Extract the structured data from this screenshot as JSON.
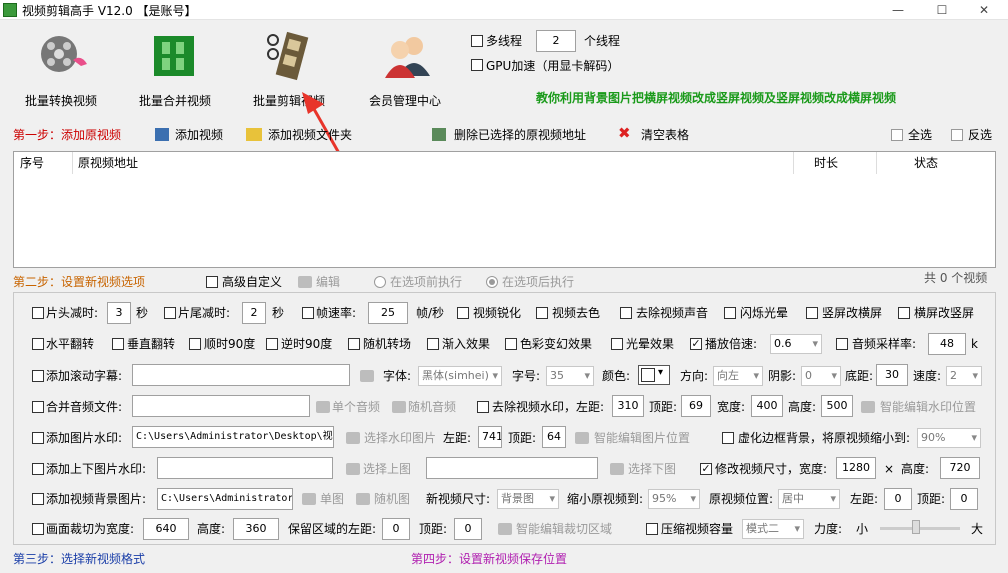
{
  "window": {
    "title": "视频剪辑高手 V12.0 【是账号】",
    "min": "—",
    "max": "☐",
    "close": "✕"
  },
  "toolbar": {
    "items": [
      {
        "label": "批量转换视频",
        "icon": "film-reel-icon"
      },
      {
        "label": "批量合并视频",
        "icon": "film-merge-icon"
      },
      {
        "label": "批量剪辑视频",
        "icon": "film-cut-icon"
      },
      {
        "label": "会员管理中心",
        "icon": "members-icon"
      }
    ],
    "multithread_label": "多线程",
    "threads": "2",
    "threads_unit": "个线程",
    "gpu_label": "GPU加速（用显卡解码）",
    "tutorial_link": "教你利用背景图片把横屏视频改成竖屏视频及竖屏视频改成横屏视频"
  },
  "step1": {
    "title": "第一步：添加原视频",
    "add_video": "添加视频",
    "add_folder": "添加视频文件夹",
    "delete_selected": "删除已选择的原视频地址",
    "clear": "清空表格",
    "select_all": "全选",
    "invert": "反选"
  },
  "table": {
    "headers": [
      "序号",
      "原视频地址",
      "时长",
      "状态"
    ]
  },
  "step2": {
    "title": "第二步：设置新视频选项",
    "advanced": "高级自定义",
    "edit": "编辑",
    "before": "在选项前执行",
    "after": "在选项后执行",
    "count": "共 0 个视频"
  },
  "row1": {
    "head_cut": "片头减时:",
    "head_val": "3",
    "sec": "秒",
    "tail_cut": "片尾减时:",
    "tail_val": "2",
    "sec2": "秒",
    "fps": "帧速率:",
    "fps_val": "25",
    "fps_unit": "帧/秒",
    "sharpen": "视频锐化",
    "decolor": "视频去色",
    "remove_audio": "去除视频声音",
    "flash": "闪烁光晕",
    "v2h": "竖屏改横屏",
    "h2v": "横屏改竖屏"
  },
  "row2": {
    "hflip": "水平翻转",
    "vflip": "垂直翻转",
    "cw90": "顺时90度",
    "ccw90": "逆时90度",
    "random_trans": "随机转场",
    "fade_in": "渐入效果",
    "color_change": "色彩变幻效果",
    "halo": "光晕效果",
    "speed": "播放倍速:",
    "speed_val": "0.6",
    "sample": "音频采样率:",
    "sample_val": "48",
    "k": "k"
  },
  "row3": {
    "scroll": "添加滚动字幕:",
    "font": "字体:",
    "font_val": "黑体(simhei)",
    "size": "字号:",
    "size_val": "35",
    "color": "颜色:",
    "dir": "方向:",
    "dir_val": "向左",
    "shadow": "阴影:",
    "shadow_val": "0",
    "bottom": "底距:",
    "bottom_val": "30",
    "speed": "速度:",
    "speed_val": "2"
  },
  "row4": {
    "merge_audio": "合并音频文件:",
    "single": "单个音频",
    "random": "随机音频",
    "remove_wm": "去除视频水印，左距:",
    "left": "310",
    "top_l": "顶距:",
    "top": "69",
    "width_l": "宽度:",
    "width": "400",
    "height_l": "高度:",
    "height": "500",
    "smart": "智能编辑水印位置"
  },
  "row5": {
    "img_wm": "添加图片水印:",
    "path": "C:\\Users\\Administrator\\Desktop\\视频",
    "choose": "选择水印图片",
    "left_l": "左距:",
    "left": "741",
    "top_l": "顶距:",
    "top": "64",
    "smart": "智能编辑图片位置",
    "blur_bg": "虚化边框背景，将原视频缩小到:",
    "blur_val": "90%"
  },
  "row6": {
    "updown": "添加上下图片水印:",
    "choose_up": "选择上图",
    "choose_down": "选择下图",
    "resize": "修改视频尺寸，宽度:",
    "w": "1280",
    "x": "×",
    "h_l": "高度:",
    "h": "720"
  },
  "row7": {
    "bg_img": "添加视频背景图片:",
    "path": "C:\\Users\\Administrator",
    "single": "单图",
    "random": "随机图",
    "new_size": "新视频尺寸:",
    "new_size_val": "背景图",
    "shrink": "缩小原视频到:",
    "shrink_val": "95%",
    "pos": "原视频位置:",
    "pos_val": "居中",
    "left_l": "左距:",
    "left": "0",
    "top_l": "顶距:",
    "top": "0"
  },
  "row8": {
    "crop": "画面裁切为宽度:",
    "w": "640",
    "h_l": "高度:",
    "h": "360",
    "keep_left": "保留区域的左距:",
    "left": "0",
    "top_l": "顶距:",
    "top": "0",
    "smart": "智能编辑裁切区域",
    "compress": "压缩视频容量",
    "mode": "模式二",
    "strength": "力度:",
    "small": "小",
    "big": "大"
  },
  "step3": {
    "title": "第三步：选择新视频格式"
  },
  "step4": {
    "title": "第四步：设置新视频保存位置"
  }
}
